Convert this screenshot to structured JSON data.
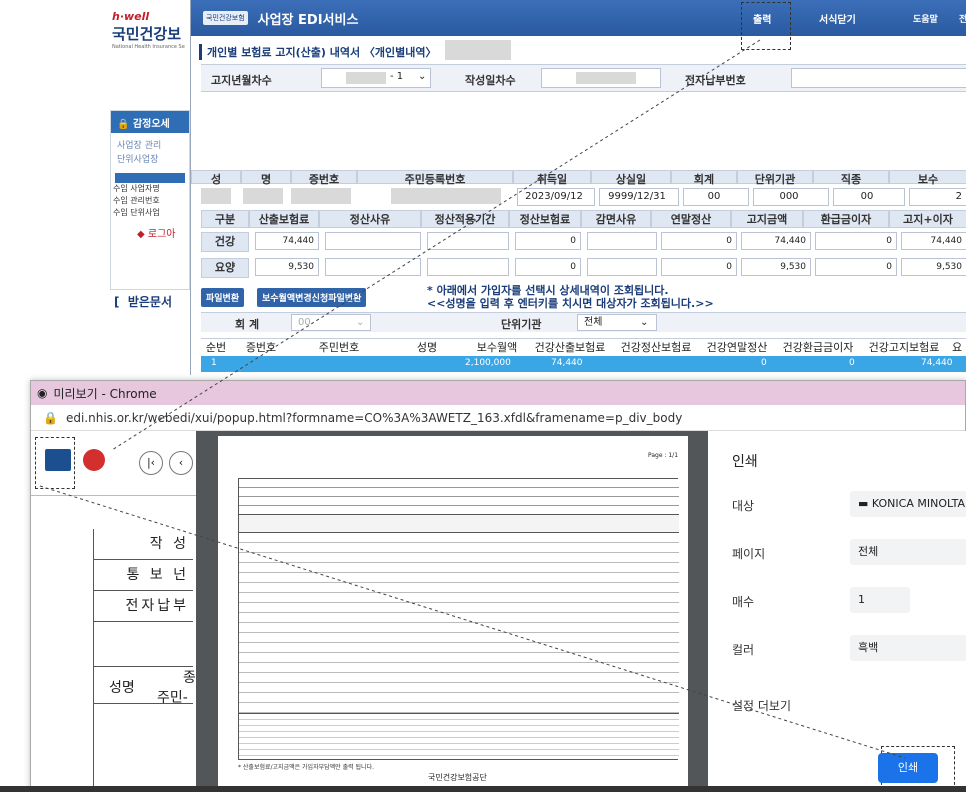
{
  "portal": {
    "brand_top": "h·well",
    "brand_name": "국민건강보",
    "brand_en": "National Health Insurance Se",
    "login_title": "감정오세",
    "menu": [
      "사업장 관리",
      "단위사업장"
    ],
    "rows": [
      "수임 사업자명",
      "수임 관리번호",
      "수임 단위사업"
    ],
    "logout": "로그아",
    "received": "받은문서"
  },
  "edi": {
    "logo": "국민건강보험",
    "service": "사업장 EDI서비스",
    "print_btn": "출력",
    "close_btn": "서식닫기",
    "help_btn": "도움말",
    "title": "개인별 보험료 고지(산출) 내역서 〈개인별내역〉",
    "filter": {
      "notice_year": "고지년월차수",
      "notice_year_val": "- 1",
      "created": "작성일차수",
      "elec": "전자납부번호"
    },
    "head1": [
      "성",
      "명",
      "증번호",
      "주민등록번호",
      "취득일",
      "상실일",
      "회계",
      "단위기관",
      "직종",
      "보수"
    ],
    "acq_date": "2023/09/12",
    "loss_date": "9999/12/31",
    "acct": "00",
    "unit": "000",
    "job": "00",
    "job2": "2",
    "head2": [
      "구분",
      "산출보험료",
      "정산사유",
      "정산적용기간",
      "정산보험료",
      "감면사유",
      "연말정산",
      "고지금액",
      "환급금이자",
      "고지+이자"
    ],
    "rows": [
      {
        "kind": "건강",
        "calc": "74,440",
        "adj": "0",
        "year": "0",
        "notice": "74,440",
        "refund": "0",
        "total": "74,440"
      },
      {
        "kind": "요양",
        "calc": "9,530",
        "adj": "0",
        "year": "0",
        "notice": "9,530",
        "refund": "0",
        "total": "9,530"
      }
    ],
    "file_btn": "파일변환",
    "req_btn": "보수월액변경신청파일변환",
    "notice1": "* 아래에서 가입자를 선택시 상세내역이 조회됩니다.",
    "notice2": "<<성명을 입력 후 엔터키를 치시면 대상자가 조회됩니다.>>",
    "acct_label": "회 계",
    "acct_val": "00",
    "unit_label": "단위기관",
    "unit_val": "전체",
    "grid_head": [
      "순번",
      "증번호",
      "주민번호",
      "성명",
      "보수월액",
      "건강산출보험료",
      "건강정산보험료",
      "건강연말정산",
      "건강환급금이자",
      "건강고지보험료",
      "요"
    ],
    "grid_row": {
      "no": "1",
      "pay": "2,100,000",
      "calc": "74,440",
      "year": "0",
      "refund": "0",
      "notice": "74,440"
    }
  },
  "preview": {
    "title": "미리보기 - Chrome",
    "url": "edi.nhis.or.kr/webedi/xui/popup.html?formname=CO%3A%3AWETZ_163.xfdl&framename=p_div_body",
    "page": "Page : 1/1",
    "footer": "국민건강보험공단",
    "footnote": "* 산출보험료/고지금액은 가입자부담액만 출력 됩니다.",
    "form_rows": [
      "작 성",
      "통 보 넌",
      "전자납부"
    ],
    "form_name": "성명",
    "form_right": [
      "종",
      "주민-"
    ]
  },
  "print": {
    "heading": "인쇄",
    "dest_label": "대상",
    "dest_val": "KONICA MINOLTA",
    "page_label": "페이지",
    "page_val": "전체",
    "copies_label": "매수",
    "copies_val": "1",
    "color_label": "컬러",
    "color_val": "흑백",
    "more": "설정 더보기",
    "print_btn": "인쇄"
  }
}
